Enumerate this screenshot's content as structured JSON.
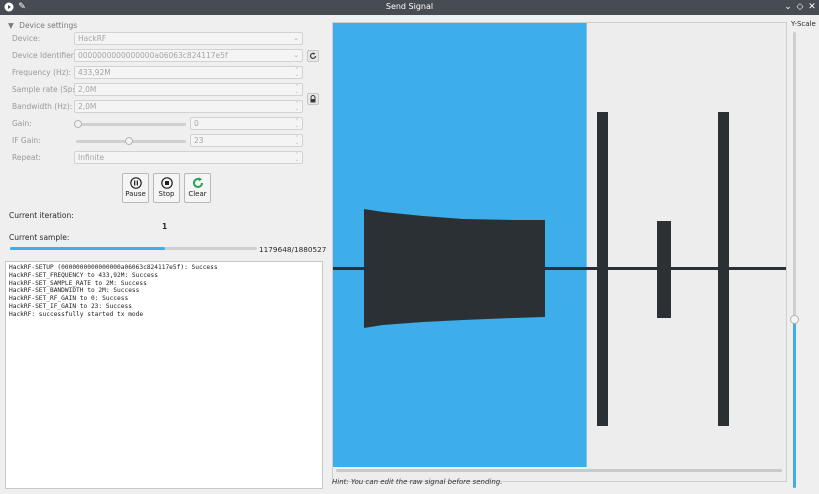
{
  "window": {
    "title": "Send Signal"
  },
  "settings": {
    "section_title": "Device settings",
    "device_label": "Device:",
    "device_value": "HackRF",
    "identifier_label": "Device Identifier:",
    "identifier_value": "0000000000000000a06063c824117e5f",
    "frequency_label": "Frequency (Hz):",
    "frequency_value": "433,92M",
    "sample_rate_label": "Sample rate (Sps):",
    "sample_rate_value": "2,0M",
    "bandwidth_label": "Bandwidth (Hz):",
    "bandwidth_value": "2,0M",
    "gain_label": "Gain:",
    "gain_value": "0",
    "if_gain_label": "IF Gain:",
    "if_gain_value": "23",
    "repeat_label": "Repeat:",
    "repeat_value": "Infinite"
  },
  "controls": {
    "pause_label": "Pause",
    "stop_label": "Stop",
    "clear_label": "Clear"
  },
  "status": {
    "iteration_label": "Current iteration:",
    "iteration_value": "1",
    "sample_label": "Current sample:",
    "sample_value": "1179648/1880527",
    "progress_fraction": 0.627
  },
  "log": [
    "HackRF-SETUP (0000000000000000a06063c824117e5f): Success",
    "HackRF-SET_FREQUENCY to 433,92M: Success",
    "HackRF-SET_SAMPLE_RATE to 2M: Success",
    "HackRF-SET_BANDWIDTH to 2M: Success",
    "HackRF-SET_RF_GAIN to 0: Success",
    "HackRF-SET_IF_GAIN to 23: Success",
    "HackRF: successfully started tx mode"
  ],
  "signal_view": {
    "hint": "Hint: You can edit the raw signal before sending.",
    "yscale_label": "Y-Scale",
    "sent_fraction": 0.56
  },
  "colors": {
    "accent": "#3daee9",
    "signal": "#2b3035",
    "titlebar": "#474c52"
  }
}
